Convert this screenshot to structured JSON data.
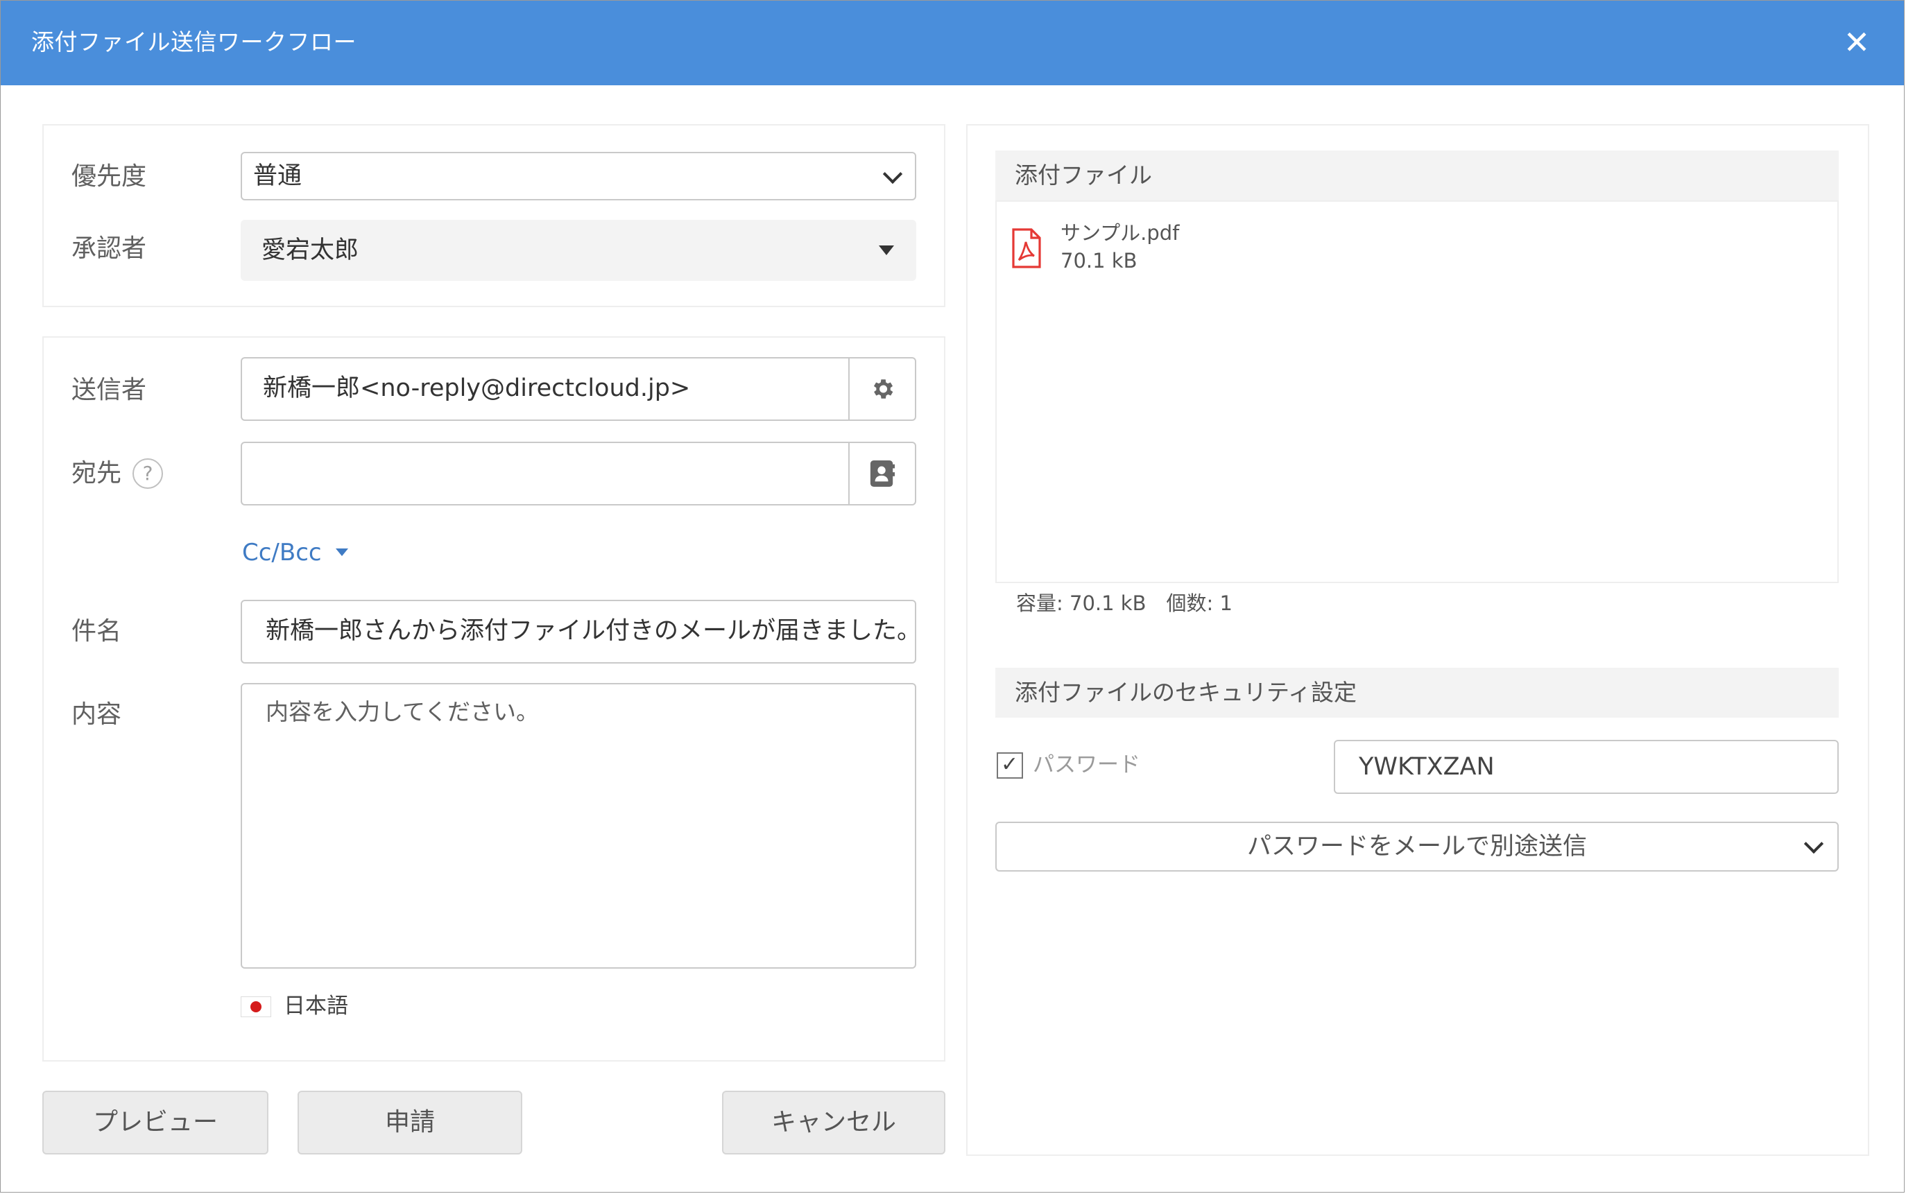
{
  "window": {
    "title": "添付ファイル送信ワークフロー",
    "close_glyph": "✕"
  },
  "priority": {
    "label": "優先度",
    "value": "普通"
  },
  "approver": {
    "label": "承認者",
    "value": "愛宕太郎"
  },
  "sender": {
    "label": "送信者",
    "value": "新橋一郎<no-reply@directcloud.jp>"
  },
  "recipient": {
    "label": "宛先",
    "help_glyph": "?",
    "value": ""
  },
  "ccbcc": {
    "label": "Cc/Bcc"
  },
  "subject": {
    "label": "件名",
    "value": "新橋一郎さんから添付ファイル付きのメールが届きました。"
  },
  "body": {
    "label": "内容",
    "placeholder": "内容を入力してください。"
  },
  "language": {
    "label": "日本語"
  },
  "buttons": {
    "preview": "プレビュー",
    "apply": "申請",
    "cancel": "キャンセル"
  },
  "attachments": {
    "header": "添付ファイル",
    "files": [
      {
        "name": "サンプル.pdf",
        "size": "70.1 kB"
      }
    ],
    "summary": "容量: 70.1 kB　個数: 1"
  },
  "security": {
    "header": "添付ファイルのセキュリティ設定",
    "password_label": "パスワード",
    "password_checked": true,
    "check_glyph": "✓",
    "password_value": "YWKTXZAN",
    "delivery_option": "パスワードをメールで別途送信"
  },
  "colors": {
    "titlebar": "#4a8edb",
    "link": "#3f7bc4",
    "pdf": "#e53935"
  }
}
